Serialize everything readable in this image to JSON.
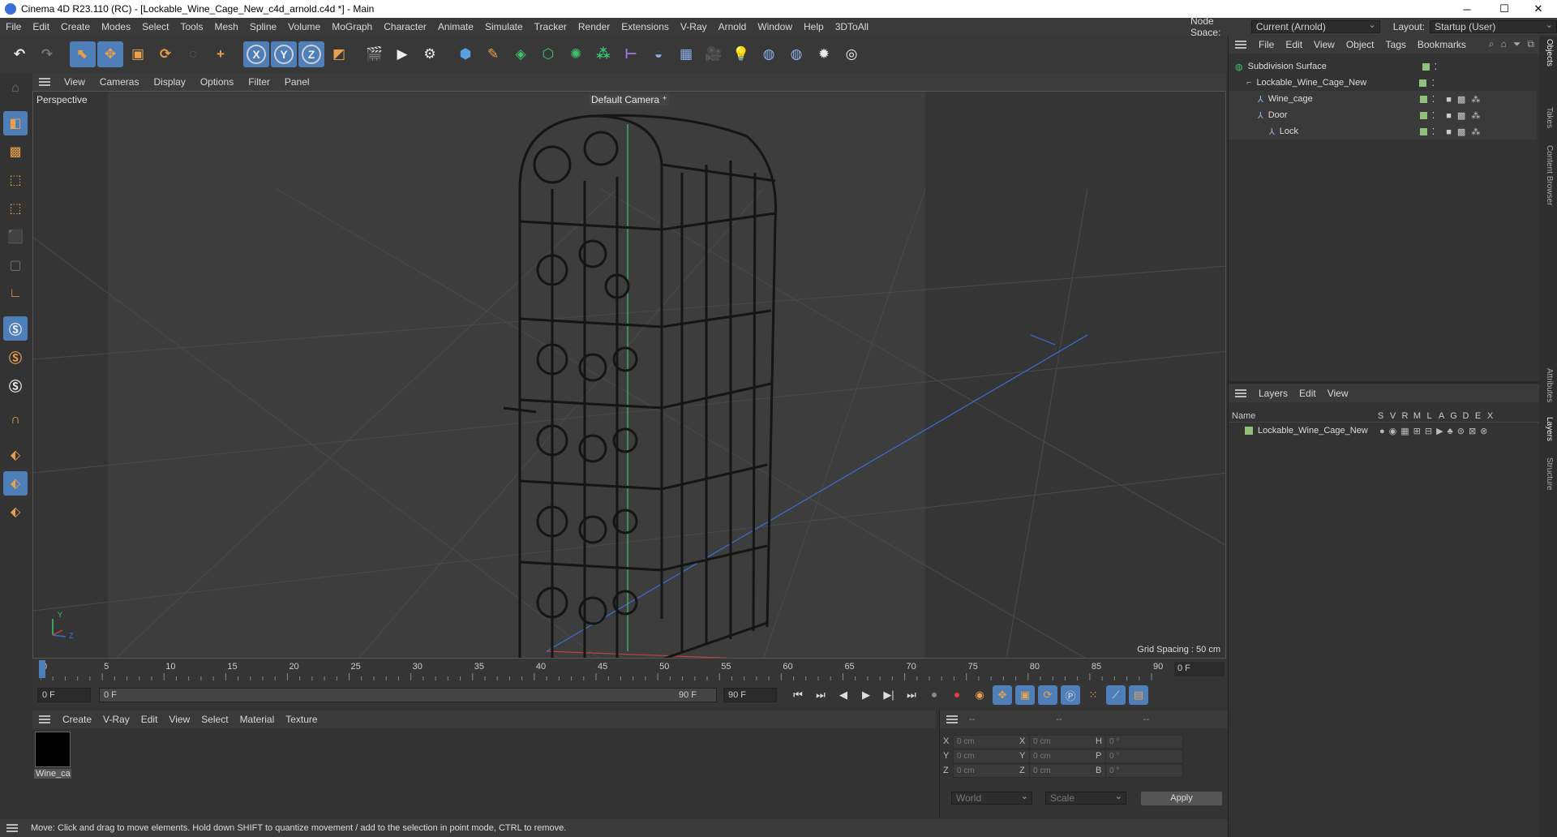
{
  "window": {
    "title": "Cinema 4D R23.110 (RC) - [Lockable_Wine_Cage_New_c4d_arnold.c4d *] - Main",
    "minimize": "─",
    "maximize": "☐",
    "close": "✕"
  },
  "menubar": {
    "items": [
      "File",
      "Edit",
      "Create",
      "Modes",
      "Select",
      "Tools",
      "Mesh",
      "Spline",
      "Volume",
      "MoGraph",
      "Character",
      "Animate",
      "Simulate",
      "Tracker",
      "Render",
      "Extensions",
      "V-Ray",
      "Arnold",
      "Window",
      "Help",
      "3DToAll"
    ],
    "node_space_label": "Node Space:",
    "node_space_value": "Current (Arnold)",
    "layout_label": "Layout:",
    "layout_value": "Startup (User)"
  },
  "viewport": {
    "menu": [
      "View",
      "Cameras",
      "Display",
      "Options",
      "Filter",
      "Panel"
    ],
    "label": "Perspective",
    "camera": "Default Camera",
    "grid_spacing": "Grid Spacing : 50 cm",
    "axis_y": "Y",
    "axis_z": "Z"
  },
  "timeline": {
    "ticks": [
      "0",
      "5",
      "10",
      "15",
      "20",
      "25",
      "30",
      "35",
      "40",
      "45",
      "50",
      "55",
      "60",
      "65",
      "70",
      "75",
      "80",
      "85",
      "90"
    ],
    "current_frame": "0 F"
  },
  "playbar": {
    "start": "0 F",
    "range_start": "0 F",
    "range_end": "90 F",
    "end": "90 F"
  },
  "material": {
    "menu": [
      "Create",
      "V-Ray",
      "Edit",
      "View",
      "Select",
      "Material",
      "Texture"
    ],
    "items": [
      {
        "name": "Wine_ca"
      }
    ]
  },
  "coords": {
    "hdr1": "--",
    "hdr2": "--",
    "hdr3": "--",
    "rows": [
      {
        "a": "X",
        "av": "0 cm",
        "b": "X",
        "bv": "0 cm",
        "c": "H",
        "cv": "0 °"
      },
      {
        "a": "Y",
        "av": "0 cm",
        "b": "Y",
        "bv": "0 cm",
        "c": "P",
        "cv": "0 °"
      },
      {
        "a": "Z",
        "av": "0 cm",
        "b": "Z",
        "bv": "0 cm",
        "c": "B",
        "cv": "0 °"
      }
    ],
    "world": "World",
    "scale": "Scale",
    "apply": "Apply"
  },
  "status": "Move: Click and drag to move elements. Hold down SHIFT to quantize movement / add to the selection in point mode, CTRL to remove.",
  "objects": {
    "menu": [
      "File",
      "Edit",
      "View",
      "Object",
      "Tags",
      "Bookmarks"
    ],
    "tree": [
      {
        "name": "Subdivision Surface",
        "indent": 0
      },
      {
        "name": "Lockable_Wine_Cage_New",
        "indent": 1
      },
      {
        "name": "Wine_cage",
        "indent": 2
      },
      {
        "name": "Door",
        "indent": 2
      },
      {
        "name": "Lock",
        "indent": 3
      }
    ]
  },
  "layers": {
    "menu": [
      "Layers",
      "Edit",
      "View"
    ],
    "col_name": "Name",
    "cols": [
      "S",
      "V",
      "R",
      "M",
      "L",
      "A",
      "G",
      "D",
      "E",
      "X"
    ],
    "items": [
      {
        "name": "Lockable_Wine_Cage_New"
      }
    ]
  },
  "sidetabs": [
    "Objects",
    "Takes",
    "Content Browser",
    "Attributes",
    "Layers",
    "Structure"
  ],
  "colors": {
    "accent": "#4f7fb8",
    "orange": "#e9a04c",
    "green_axis": "#3ec46d",
    "blue_axis": "#3a6fd8",
    "red_axis": "#c84040"
  }
}
